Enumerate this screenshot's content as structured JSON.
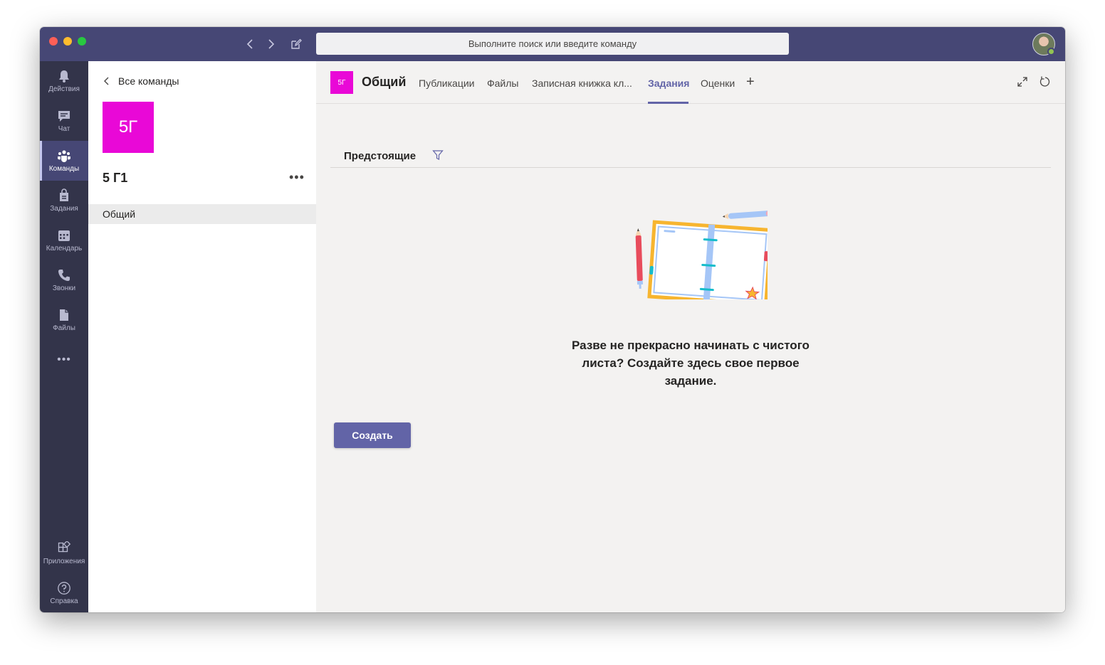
{
  "window": {
    "search_placeholder": "Выполните поиск или введите команду"
  },
  "rail": {
    "items": [
      {
        "label": "Действия",
        "icon": "bell-icon"
      },
      {
        "label": "Чат",
        "icon": "chat-icon"
      },
      {
        "label": "Команды",
        "icon": "teams-icon",
        "active": true
      },
      {
        "label": "Задания",
        "icon": "assignments-icon"
      },
      {
        "label": "Календарь",
        "icon": "calendar-icon"
      },
      {
        "label": "Звонки",
        "icon": "phone-icon"
      },
      {
        "label": "Файлы",
        "icon": "files-icon"
      }
    ],
    "more": "•••",
    "bottom": [
      {
        "label": "Приложения",
        "icon": "apps-icon"
      },
      {
        "label": "Справка",
        "icon": "help-icon"
      }
    ]
  },
  "leftpane": {
    "back_label": "Все команды",
    "team_tile": "5Г",
    "team_name": "5 Г1",
    "more": "•••",
    "channels": [
      "Общий"
    ]
  },
  "main": {
    "channel_tile": "5Г",
    "channel_title": "Общий",
    "tabs": [
      "Публикации",
      "Файлы",
      "Записная книжка кл...",
      "Задания",
      "Оценки"
    ],
    "active_tab": "Задания",
    "add_tab": "+",
    "subhead": "Предстоящие",
    "empty_message": "Разве не прекрасно начинать с чистого листа? Создайте здесь свое первое задание.",
    "create_button": "Создать"
  },
  "colors": {
    "titlebar": "#464775",
    "rail": "#33344a",
    "accent": "#6264a7",
    "team_tile": "#e908d7"
  }
}
